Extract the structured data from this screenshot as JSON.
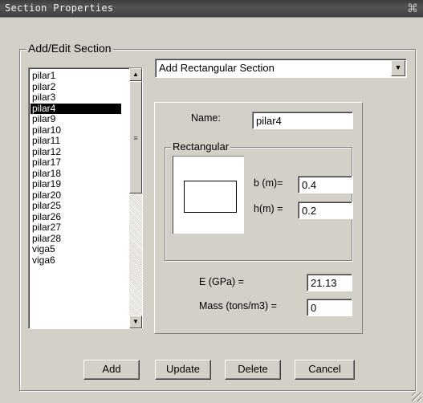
{
  "window": {
    "title": "Section Properties",
    "close_glyph": "⌘"
  },
  "group": {
    "label": "Add/Edit Section"
  },
  "sections_list": {
    "items": [
      "pilar1",
      "pilar2",
      "pilar3",
      "pilar4",
      "pilar9",
      "pilar10",
      "pilar11",
      "pilar12",
      "pilar17",
      "pilar18",
      "pilar19",
      "pilar20",
      "pilar25",
      "pilar26",
      "pilar27",
      "pilar28",
      "viga5",
      "viga6"
    ],
    "selected": "pilar4"
  },
  "section_type": {
    "selected": "Add Rectangular Section"
  },
  "form": {
    "name_label": "Name:",
    "name_value": "pilar4",
    "rect_group_label": "Rectangular",
    "b_label": "b (m)=",
    "b_value": "0.4",
    "h_label": "h(m) =",
    "h_value": "0.2",
    "e_label": "E (GPa) =",
    "e_value": "21.13",
    "mass_label": "Mass (tons/m3) =",
    "mass_value": "0"
  },
  "buttons": {
    "add": "Add",
    "update": "Update",
    "delete": "Delete",
    "cancel": "Cancel"
  },
  "icons": {
    "close": "close-icon",
    "scroll_up": "arrow-up-icon",
    "scroll_down": "arrow-down-icon",
    "dropdown": "chevron-down-icon"
  }
}
